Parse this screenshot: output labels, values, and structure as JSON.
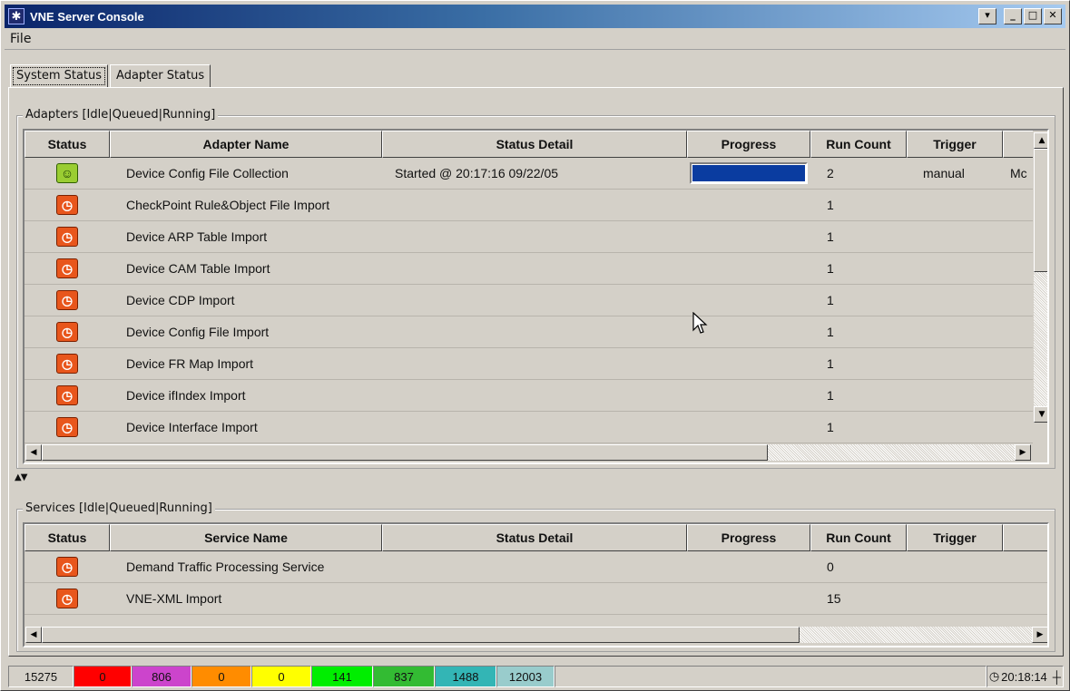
{
  "window": {
    "title": "VNE Server Console",
    "icon": "asterisk-icon"
  },
  "menu": {
    "file": "File"
  },
  "tabs": [
    {
      "label": "System Status",
      "active": true
    },
    {
      "label": "Adapter Status",
      "active": false
    }
  ],
  "adapters": {
    "title": "Adapters [Idle|Queued|Running]",
    "columns": [
      "Status",
      "Adapter Name",
      "Status Detail",
      "Progress",
      "Run Count",
      "Trigger"
    ],
    "rows": [
      {
        "status": "running",
        "name": "Device Config File Collection",
        "detail": "Started @ 20:17:16 09/22/05",
        "progress": 1.0,
        "run_count": "2",
        "trigger": "manual",
        "extra": "Mc"
      },
      {
        "status": "queued",
        "name": "CheckPoint Rule&Object File Import",
        "detail": "",
        "progress": null,
        "run_count": "1",
        "trigger": "",
        "extra": ""
      },
      {
        "status": "queued",
        "name": "Device ARP Table Import",
        "detail": "",
        "progress": null,
        "run_count": "1",
        "trigger": "",
        "extra": ""
      },
      {
        "status": "queued",
        "name": "Device CAM Table Import",
        "detail": "",
        "progress": null,
        "run_count": "1",
        "trigger": "",
        "extra": ""
      },
      {
        "status": "queued",
        "name": "Device CDP Import",
        "detail": "",
        "progress": null,
        "run_count": "1",
        "trigger": "",
        "extra": ""
      },
      {
        "status": "queued",
        "name": "Device Config File Import",
        "detail": "",
        "progress": null,
        "run_count": "1",
        "trigger": "",
        "extra": ""
      },
      {
        "status": "queued",
        "name": "Device FR Map Import",
        "detail": "",
        "progress": null,
        "run_count": "1",
        "trigger": "",
        "extra": ""
      },
      {
        "status": "queued",
        "name": "Device ifIndex Import",
        "detail": "",
        "progress": null,
        "run_count": "1",
        "trigger": "",
        "extra": ""
      },
      {
        "status": "queued",
        "name": "Device Interface Import",
        "detail": "",
        "progress": null,
        "run_count": "1",
        "trigger": "",
        "extra": ""
      }
    ]
  },
  "services": {
    "title": "Services [Idle|Queued|Running]",
    "columns": [
      "Status",
      "Service Name",
      "Status Detail",
      "Progress",
      "Run Count",
      "Trigger"
    ],
    "rows": [
      {
        "status": "queued",
        "name": "Demand Traffic Processing Service",
        "detail": "",
        "progress": null,
        "run_count": "0",
        "trigger": ""
      },
      {
        "status": "queued",
        "name": "VNE-XML Import",
        "detail": "",
        "progress": null,
        "run_count": "15",
        "trigger": ""
      }
    ]
  },
  "statusbar": {
    "segments": [
      {
        "value": "15275",
        "color": "#d4d0c8"
      },
      {
        "value": "0",
        "color": "#ff0000"
      },
      {
        "value": "806",
        "color": "#cc44cc"
      },
      {
        "value": "0",
        "color": "#ff8c00"
      },
      {
        "value": "0",
        "color": "#ffff00"
      },
      {
        "value": "141",
        "color": "#00ee00"
      },
      {
        "value": "837",
        "color": "#33bb33"
      },
      {
        "value": "1488",
        "color": "#33b5b5"
      },
      {
        "value": "12003",
        "color": "#99cccc"
      }
    ],
    "clock": "20:18:14"
  },
  "icons": {
    "queued": "queued-clock-icon",
    "running": "running-person-icon"
  },
  "colors": {
    "title_bar": "#0a246a",
    "progress_fill": "#0a3ca0",
    "queued_icon": "#e8561c",
    "running_icon": "#9acd32"
  }
}
